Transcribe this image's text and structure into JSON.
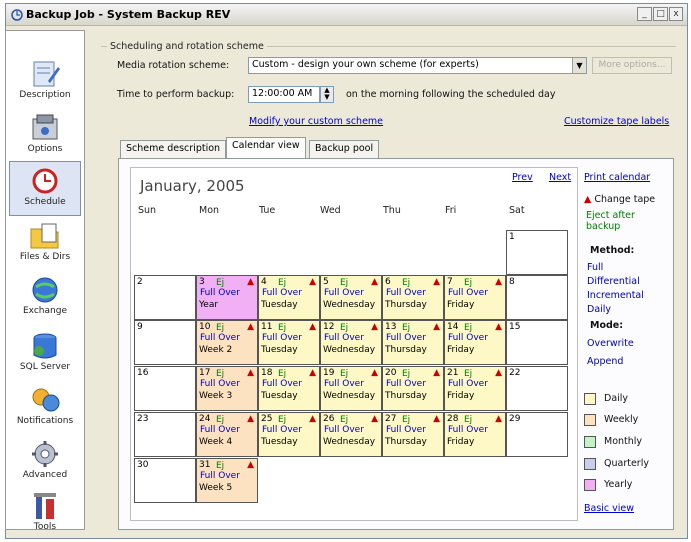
{
  "window": {
    "title": "Backup Job - System Backup REV",
    "buttons": [
      "_",
      "□",
      "x"
    ]
  },
  "sidebar": {
    "items": [
      {
        "label": "Description",
        "icon": "description-icon"
      },
      {
        "label": "Options",
        "icon": "options-icon"
      },
      {
        "label": "Schedule",
        "icon": "schedule-icon",
        "active": true
      },
      {
        "label": "Files & Dirs",
        "icon": "files-dirs-icon"
      },
      {
        "label": "Exchange",
        "icon": "exchange-icon"
      },
      {
        "label": "SQL Server",
        "icon": "sql-server-icon"
      },
      {
        "label": "Notifications",
        "icon": "notifications-icon"
      },
      {
        "label": "Advanced",
        "icon": "advanced-icon"
      },
      {
        "label": "Tools",
        "icon": "tools-icon"
      }
    ]
  },
  "scheduling": {
    "group_title": "Scheduling and rotation scheme",
    "media_label": "Media rotation scheme:",
    "media_value": "Custom - design your own scheme (for experts)",
    "more_options": "More options...",
    "time_label": "Time to perform backup:",
    "time_value": "12:00:00 AM",
    "time_suffix": "on the morning following the scheduled day",
    "modify_link": "Modify your custom scheme",
    "customize_link": "Customize tape labels"
  },
  "tabs": [
    "Scheme description",
    "Calendar view",
    "Backup pool"
  ],
  "calendar": {
    "month": "January, 2005",
    "prev": "Prev",
    "next": "Next",
    "days": [
      "Sun",
      "Mon",
      "Tue",
      "Wed",
      "Thu",
      "Fri",
      "Sat"
    ],
    "ej": "Ej",
    "change_mark": "▲",
    "full_over": "Full Over",
    "cells": [
      {
        "d": "1",
        "col": 6,
        "row": 0
      },
      {
        "d": "2",
        "col": 0,
        "row": 1
      },
      {
        "d": "3",
        "col": 1,
        "row": 1,
        "kind": "year",
        "label": "Year"
      },
      {
        "d": "4",
        "col": 2,
        "row": 1,
        "kind": "day",
        "label": "Tuesday"
      },
      {
        "d": "5",
        "col": 3,
        "row": 1,
        "kind": "day",
        "label": "Wednesday"
      },
      {
        "d": "6",
        "col": 4,
        "row": 1,
        "kind": "day",
        "label": "Thursday"
      },
      {
        "d": "7",
        "col": 5,
        "row": 1,
        "kind": "day",
        "label": "Friday"
      },
      {
        "d": "8",
        "col": 6,
        "row": 1
      },
      {
        "d": "9",
        "col": 0,
        "row": 2
      },
      {
        "d": "10",
        "col": 1,
        "row": 2,
        "kind": "week",
        "label": "Week 2"
      },
      {
        "d": "11",
        "col": 2,
        "row": 2,
        "kind": "day",
        "label": "Tuesday"
      },
      {
        "d": "12",
        "col": 3,
        "row": 2,
        "kind": "day",
        "label": "Wednesday"
      },
      {
        "d": "13",
        "col": 4,
        "row": 2,
        "kind": "day",
        "label": "Thursday"
      },
      {
        "d": "14",
        "col": 5,
        "row": 2,
        "kind": "day",
        "label": "Friday"
      },
      {
        "d": "15",
        "col": 6,
        "row": 2
      },
      {
        "d": "16",
        "col": 0,
        "row": 3
      },
      {
        "d": "17",
        "col": 1,
        "row": 3,
        "kind": "week",
        "label": "Week 3"
      },
      {
        "d": "18",
        "col": 2,
        "row": 3,
        "kind": "day",
        "label": "Tuesday"
      },
      {
        "d": "19",
        "col": 3,
        "row": 3,
        "kind": "day",
        "label": "Wednesday"
      },
      {
        "d": "20",
        "col": 4,
        "row": 3,
        "kind": "day",
        "label": "Thursday"
      },
      {
        "d": "21",
        "col": 5,
        "row": 3,
        "kind": "day",
        "label": "Friday"
      },
      {
        "d": "22",
        "col": 6,
        "row": 3
      },
      {
        "d": "23",
        "col": 0,
        "row": 4
      },
      {
        "d": "24",
        "col": 1,
        "row": 4,
        "kind": "week",
        "label": "Week 4"
      },
      {
        "d": "25",
        "col": 2,
        "row": 4,
        "kind": "day",
        "label": "Tuesday"
      },
      {
        "d": "26",
        "col": 3,
        "row": 4,
        "kind": "day",
        "label": "Wednesday"
      },
      {
        "d": "27",
        "col": 4,
        "row": 4,
        "kind": "day",
        "label": "Thursday"
      },
      {
        "d": "28",
        "col": 5,
        "row": 4,
        "kind": "day",
        "label": "Friday"
      },
      {
        "d": "29",
        "col": 6,
        "row": 4
      },
      {
        "d": "30",
        "col": 0,
        "row": 5
      },
      {
        "d": "31",
        "col": 1,
        "row": 5,
        "kind": "week",
        "label": "Week 5"
      }
    ]
  },
  "legend": {
    "print_link": "Print calendar",
    "change_tape": "Change tape",
    "eject_after": "Eject after backup",
    "method_title": "Method:",
    "methods": [
      "Full",
      "Differential",
      "Incremental",
      "Daily"
    ],
    "mode_title": "Mode:",
    "modes": [
      "Overwrite",
      "Append"
    ],
    "periods": [
      {
        "label": "Daily",
        "color": "#fdf8c6"
      },
      {
        "label": "Weekly",
        "color": "#fde2c2"
      },
      {
        "label": "Monthly",
        "color": "#c4f2c4"
      },
      {
        "label": "Quarterly",
        "color": "#c8cfee"
      },
      {
        "label": "Yearly",
        "color": "#f2b0f4"
      }
    ],
    "basic_view": "Basic view"
  }
}
